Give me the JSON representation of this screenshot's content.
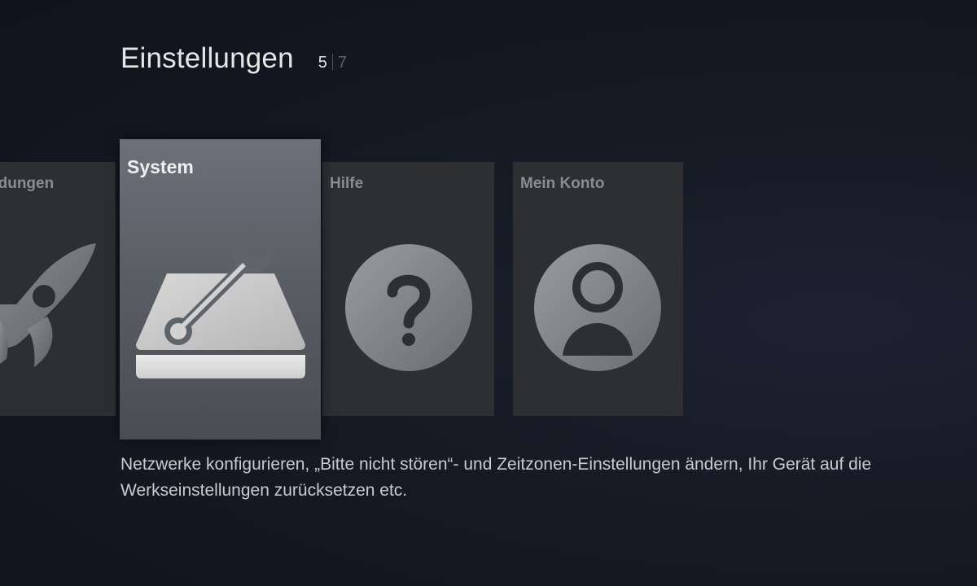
{
  "header": {
    "title": "Einstellungen",
    "page_current": "5",
    "page_total": "7"
  },
  "tiles": [
    {
      "label": "ndungen",
      "icon": "rocket-icon",
      "selected": false
    },
    {
      "label": "System",
      "icon": "tools-icon",
      "selected": true
    },
    {
      "label": "Hilfe",
      "icon": "help-icon",
      "selected": false
    },
    {
      "label": "Mein Konto",
      "icon": "account-icon",
      "selected": false
    }
  ],
  "description": "Netzwerke konfigurieren, „Bitte nicht stören“- und Zeitzonen-Einstellungen ändern, Ihr Gerät auf die Werkseinstellungen zurücksetzen etc.",
  "colors": {
    "background": "#151a24",
    "tile": "#2d2f33",
    "tile_selected": "#5f636a",
    "text": "#e6e6e6"
  }
}
